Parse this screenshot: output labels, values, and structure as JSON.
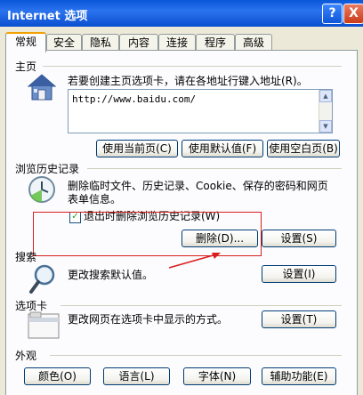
{
  "window": {
    "title": "Internet 选项",
    "help_label": "?",
    "close_label": "X"
  },
  "tabs": [
    {
      "label": "常规",
      "active": true
    },
    {
      "label": "安全"
    },
    {
      "label": "隐私"
    },
    {
      "label": "内容"
    },
    {
      "label": "连接"
    },
    {
      "label": "程序"
    },
    {
      "label": "高级"
    }
  ],
  "homepage": {
    "section_title": "主页",
    "description": "若要创建主页选项卡，请在各地址行键入地址(R)。",
    "url": "http://www.baidu.com/",
    "use_current_label": "使用当前页(C)",
    "use_default_label": "使用默认值(F)",
    "use_blank_label": "使用空白页(B)",
    "icon": "house-icon"
  },
  "history": {
    "section_title": "浏览历史记录",
    "description_line1": "删除临时文件、历史记录、Cookie、保存的密码和网页",
    "description_line2": "表单信息。",
    "delete_on_exit_label": "退出时删除浏览历史记录(W)",
    "delete_on_exit_checked": true,
    "delete_label": "删除(D)...",
    "settings_label": "设置(S)",
    "icon": "clock-icon",
    "highlight_color": "#d81e1e"
  },
  "search": {
    "section_title": "搜索",
    "description": "更改搜索默认值。",
    "settings_label": "设置(I)",
    "icon": "magnifier-icon"
  },
  "tabs_section": {
    "section_title": "选项卡",
    "description": "更改网页在选项卡中显示的方式。",
    "settings_label": "设置(T)",
    "icon": "tab-window-icon"
  },
  "appearance": {
    "section_title": "外观",
    "colors_label": "颜色(O)",
    "languages_label": "语言(L)",
    "fonts_label": "字体(N)",
    "accessibility_label": "辅助功能(E)"
  }
}
